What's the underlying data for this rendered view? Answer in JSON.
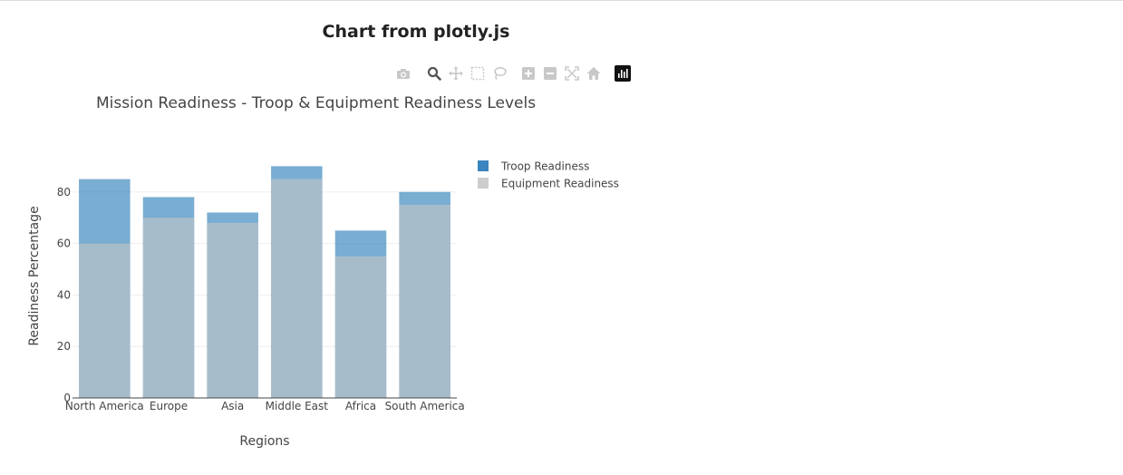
{
  "page": {
    "title": "Chart from plotly.js"
  },
  "modebar": {
    "buttons": [
      {
        "name": "camera-icon",
        "label": "Download plot as a png"
      },
      {
        "name": "zoom-icon",
        "label": "Zoom"
      },
      {
        "name": "pan-icon",
        "label": "Pan"
      },
      {
        "name": "box-select-icon",
        "label": "Box Select"
      },
      {
        "name": "lasso-select-icon",
        "label": "Lasso Select"
      },
      {
        "name": "zoom-in-icon",
        "label": "Zoom in"
      },
      {
        "name": "zoom-out-icon",
        "label": "Zoom out"
      },
      {
        "name": "autoscale-icon",
        "label": "Autoscale"
      },
      {
        "name": "reset-axes-icon",
        "label": "Reset axes"
      },
      {
        "name": "plotly-logo-icon",
        "label": "Produced with Plotly"
      }
    ],
    "active": "zoom-icon",
    "colors": {
      "inactive": "#c8c8c8",
      "active": "#555555",
      "logo_bg": "#111111"
    }
  },
  "chart_data": {
    "type": "bar",
    "barmode": "overlay",
    "title": "Mission Readiness - Troop & Equipment Readiness Levels",
    "xlabel": "Regions",
    "ylabel": "Readiness Percentage",
    "categories": [
      "North America",
      "Europe",
      "Asia",
      "Middle East",
      "Africa",
      "South America"
    ],
    "series": [
      {
        "name": "Troop Readiness",
        "values": [
          85,
          78,
          72,
          90,
          65,
          80
        ],
        "color": "#1f77b4",
        "opacity": 0.6
      },
      {
        "name": "Equipment Readiness",
        "values": [
          60,
          70,
          68,
          85,
          55,
          75
        ],
        "color": "#c7c7c7",
        "opacity": 0.6
      }
    ],
    "ylim": [
      0,
      94.7
    ],
    "yticks": [
      0,
      20,
      40,
      60,
      80
    ],
    "grid": true,
    "legend_position": "right",
    "colors": {
      "text": "#444444",
      "grid": "#eeeeee",
      "axis": "#444444"
    }
  }
}
